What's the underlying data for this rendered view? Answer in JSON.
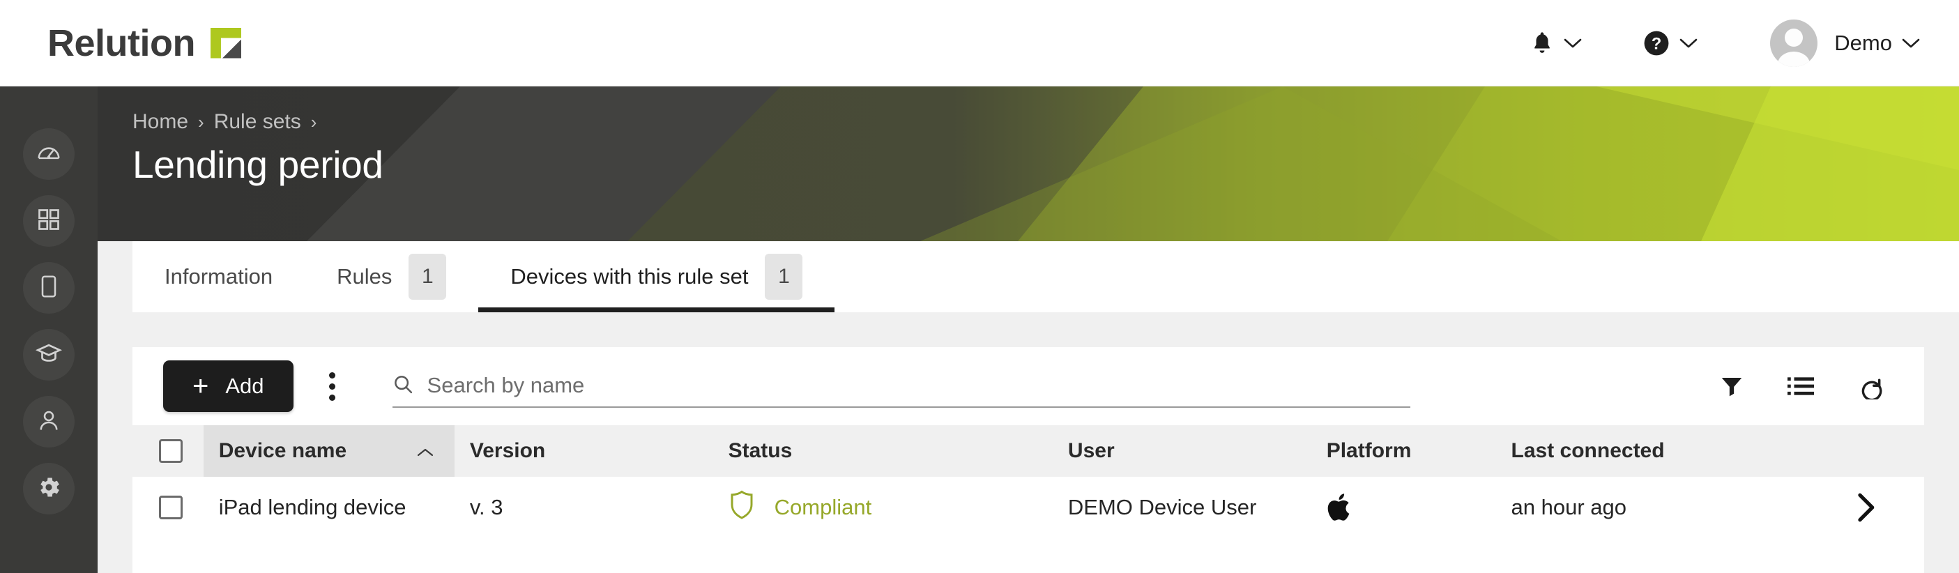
{
  "brand": {
    "name": "Relution",
    "logo_icon": "relution-logo-mark",
    "accent": "#aec81e"
  },
  "topbar": {
    "notifications_icon": "bell-icon",
    "help_icon": "help-circle-icon",
    "chevron_icon": "chevron-down-icon",
    "avatar_icon": "user-avatar",
    "user_name": "Demo"
  },
  "sidebar": {
    "items": [
      {
        "name": "dashboard",
        "icon": "speedometer-icon"
      },
      {
        "name": "apps",
        "icon": "grid-icon"
      },
      {
        "name": "devices",
        "icon": "tablet-icon"
      },
      {
        "name": "education",
        "icon": "graduation-cap-icon"
      },
      {
        "name": "users",
        "icon": "user-icon"
      },
      {
        "name": "settings",
        "icon": "gear-icon"
      }
    ]
  },
  "hero": {
    "breadcrumb": [
      {
        "label": "Home"
      },
      {
        "label": "Rule sets"
      }
    ],
    "separator": "›",
    "title": "Lending period"
  },
  "tabs": [
    {
      "label": "Information",
      "badge": null,
      "active": false
    },
    {
      "label": "Rules",
      "badge": "1",
      "active": false
    },
    {
      "label": "Devices with this rule set",
      "badge": "1",
      "active": true
    }
  ],
  "toolbar": {
    "add_label": "Add",
    "add_icon": "plus-icon",
    "more_icon": "kebab-menu-icon",
    "search_placeholder": "Search by name",
    "search_value": "",
    "search_icon": "search-icon",
    "filter_icon": "filter-funnel-icon",
    "list_icon": "list-view-icon",
    "refresh_icon": "refresh-icon"
  },
  "table": {
    "select_all_checkbox": false,
    "sort_column": "Device name",
    "sort_direction": "asc",
    "sort_icon": "chevron-up-icon",
    "columns": [
      {
        "key": "device_name",
        "label": "Device name"
      },
      {
        "key": "version",
        "label": "Version"
      },
      {
        "key": "status",
        "label": "Status"
      },
      {
        "key": "user",
        "label": "User"
      },
      {
        "key": "platform",
        "label": "Platform"
      },
      {
        "key": "last_connected",
        "label": "Last connected"
      }
    ],
    "rows": [
      {
        "checked": false,
        "device_name": "iPad lending device",
        "version": "v. 3",
        "status": "Compliant",
        "status_icon": "shield-icon",
        "status_color": "#96a82a",
        "user": "DEMO Device User",
        "platform_icon": "apple-icon",
        "last_connected": "an hour ago",
        "detail_icon": "chevron-right-icon"
      }
    ]
  }
}
